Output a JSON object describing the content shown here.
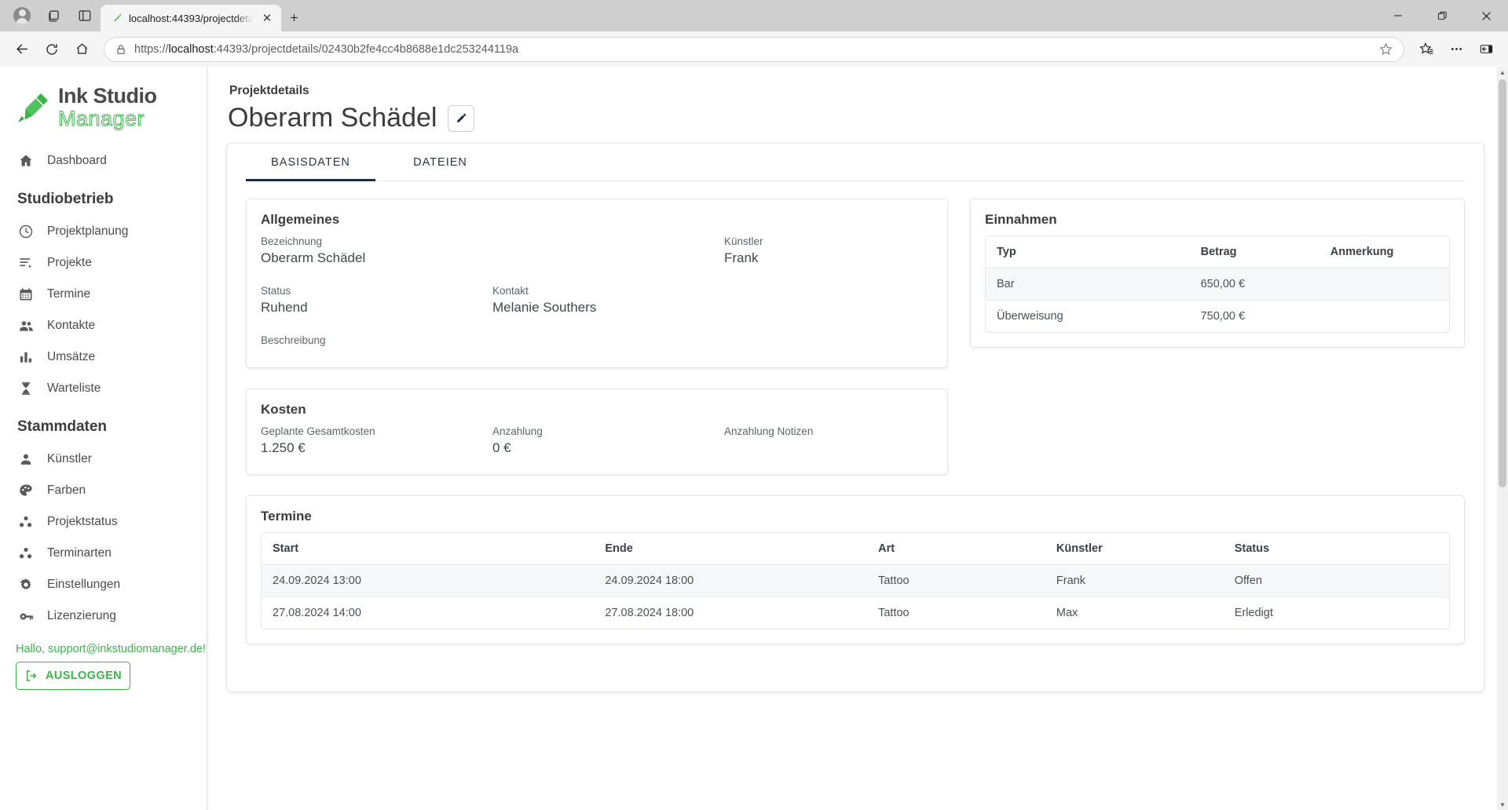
{
  "browser": {
    "tab": {
      "title": "localhost:44393/projectdetails/02…",
      "favicon_icon": "ink-pen-icon",
      "close_icon": "close-icon"
    },
    "new_tab_icon": "plus-icon",
    "profile_icon": "account-avatar-icon",
    "workspaces_icon": "workspaces-icon",
    "tab_actions_icon": "tab-actions-icon",
    "window": {
      "minimize_icon": "minimize-icon",
      "maximize_icon": "restore-icon",
      "close_icon": "window-close-icon"
    },
    "toolbar": {
      "back_icon": "back-arrow-icon",
      "reload_icon": "reload-icon",
      "home_icon": "home-icon",
      "lock_icon": "site-information-lock-icon",
      "url_scheme": "https://",
      "url_host": "localhost",
      "url_rest": ":44393/projectdetails/02430b2fe4cc4b8688e1dc253244119a",
      "url_full": "https://localhost:44393/projectdetails/02430b2fe4cc4b8688e1dc253244119a",
      "favorite_icon": "star-icon",
      "favorites_icon": "favorites-list-icon",
      "settings_icon": "more-ellipsis-icon",
      "sidebar_icon": "browser-essentials-icon"
    }
  },
  "sidebar": {
    "logo": {
      "line1": "Ink Studio",
      "line2": "Manager",
      "icon": "tattoo-machine-icon",
      "accent": "#3bb54a"
    },
    "dashboard": {
      "label": "Dashboard",
      "icon": "home-icon"
    },
    "sections": [
      {
        "title": "Studiobetrieb",
        "items": [
          {
            "label": "Projektplanung",
            "icon": "clock-icon"
          },
          {
            "label": "Projekte",
            "icon": "list-edit-icon"
          },
          {
            "label": "Termine",
            "icon": "calendar-icon"
          },
          {
            "label": "Kontakte",
            "icon": "people-icon"
          },
          {
            "label": "Umsätze",
            "icon": "bar-chart-icon"
          },
          {
            "label": "Warteliste",
            "icon": "hourglass-icon"
          }
        ]
      },
      {
        "title": "Stammdaten",
        "items": [
          {
            "label": "Künstler",
            "icon": "person-icon"
          },
          {
            "label": "Farben",
            "icon": "palette-icon"
          },
          {
            "label": "Projektstatus",
            "icon": "bubbles-icon"
          },
          {
            "label": "Terminarten",
            "icon": "bubbles-icon"
          },
          {
            "label": "Einstellungen",
            "icon": "gear-icon"
          },
          {
            "label": "Lizenzierung",
            "icon": "key-icon"
          }
        ]
      }
    ],
    "greeting": "Hallo, support@inkstudiomanager.de!",
    "logout": {
      "label": "AUSLOGGEN",
      "icon": "logout-icon"
    }
  },
  "main": {
    "breadcrumb": "Projektdetails",
    "title": "Oberarm Schädel",
    "edit_icon": "pencil-edit-icon",
    "tabs": [
      {
        "label": "BASISDATEN",
        "active": true
      },
      {
        "label": "DATEIEN",
        "active": false
      }
    ],
    "allgemeines": {
      "title": "Allgemeines",
      "bezeichnung_label": "Bezeichnung",
      "bezeichnung_value": "Oberarm Schädel",
      "kuenstler_label": "Künstler",
      "kuenstler_value": "Frank",
      "status_label": "Status",
      "status_value": "Ruhend",
      "kontakt_label": "Kontakt",
      "kontakt_value": "Melanie Southers",
      "beschreibung_label": "Beschreibung",
      "beschreibung_value": ""
    },
    "kosten": {
      "title": "Kosten",
      "gesamtkosten_label": "Geplante Gesamtkosten",
      "gesamtkosten_value": "1.250 €",
      "anzahlung_label": "Anzahlung",
      "anzahlung_value": "0 €",
      "anzahlung_notizen_label": "Anzahlung Notizen",
      "anzahlung_notizen_value": ""
    },
    "einnahmen": {
      "title": "Einnahmen",
      "columns": [
        "Typ",
        "Betrag",
        "Anmerkung"
      ],
      "rows": [
        {
          "typ": "Bar",
          "betrag": "650,00 €",
          "anmerkung": ""
        },
        {
          "typ": "Überweisung",
          "betrag": "750,00 €",
          "anmerkung": ""
        }
      ]
    },
    "termine": {
      "title": "Termine",
      "columns": [
        "Start",
        "Ende",
        "Art",
        "Künstler",
        "Status"
      ],
      "rows": [
        {
          "start": "24.09.2024 13:00",
          "ende": "24.09.2024 18:00",
          "art": "Tattoo",
          "kuenstler": "Frank",
          "status": "Offen"
        },
        {
          "start": "27.08.2024 14:00",
          "ende": "27.08.2024 18:00",
          "art": "Tattoo",
          "kuenstler": "Max",
          "status": "Erledigt"
        }
      ]
    }
  }
}
